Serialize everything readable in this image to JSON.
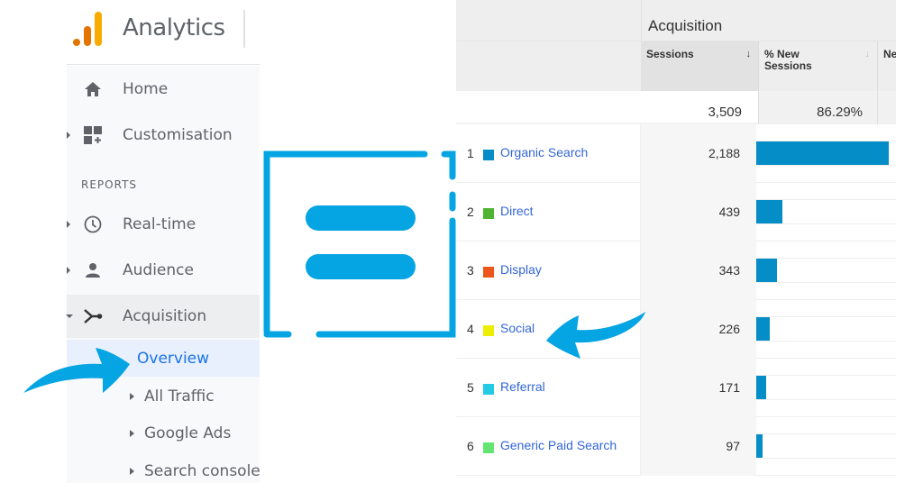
{
  "sidebar": {
    "app_title": "Analytics",
    "nav": {
      "home": "Home",
      "customisation": "Customisation",
      "section_reports": "REPORTS",
      "realtime": "Real-time",
      "audience": "Audience",
      "acquisition": "Acquisition"
    },
    "acquisition_sub": {
      "overview": "Overview",
      "all_traffic": "All Traffic",
      "google_ads": "Google Ads",
      "search_console": "Search console"
    },
    "logo_colors": [
      "#e37400",
      "#f9ab00"
    ],
    "active_color": "#1a73e8"
  },
  "table": {
    "group_header": "Acquisition",
    "columns": {
      "sessions": "Sessions",
      "new_sessions_line1": "% New",
      "new_sessions_line2": "Sessions",
      "next_truncated": "Ne"
    },
    "sort_icon": "↓",
    "totals": {
      "sessions": "3,509",
      "new_sessions": "86.29%"
    },
    "bar_color": "#058dc7",
    "rows": [
      {
        "index": "1",
        "channel": "Organic Search",
        "color": "#058dc7",
        "sessions": "2,188",
        "value": 2188
      },
      {
        "index": "2",
        "channel": "Direct",
        "color": "#50b432",
        "sessions": "439",
        "value": 439
      },
      {
        "index": "3",
        "channel": "Display",
        "color": "#ed561b",
        "sessions": "343",
        "value": 343
      },
      {
        "index": "4",
        "channel": "Social",
        "color": "#edef00",
        "sessions": "226",
        "value": 226
      },
      {
        "index": "5",
        "channel": "Referral",
        "color": "#24cbe5",
        "sessions": "171",
        "value": 171
      },
      {
        "index": "6",
        "channel": "Generic Paid Search",
        "color": "#64e572",
        "sessions": "97",
        "value": 97
      }
    ]
  },
  "decor": {
    "accent_color": "#05a4e2",
    "center_icon": "equals-bracket-logo",
    "arrows": [
      "arrow-to-overview",
      "arrow-to-social"
    ]
  }
}
